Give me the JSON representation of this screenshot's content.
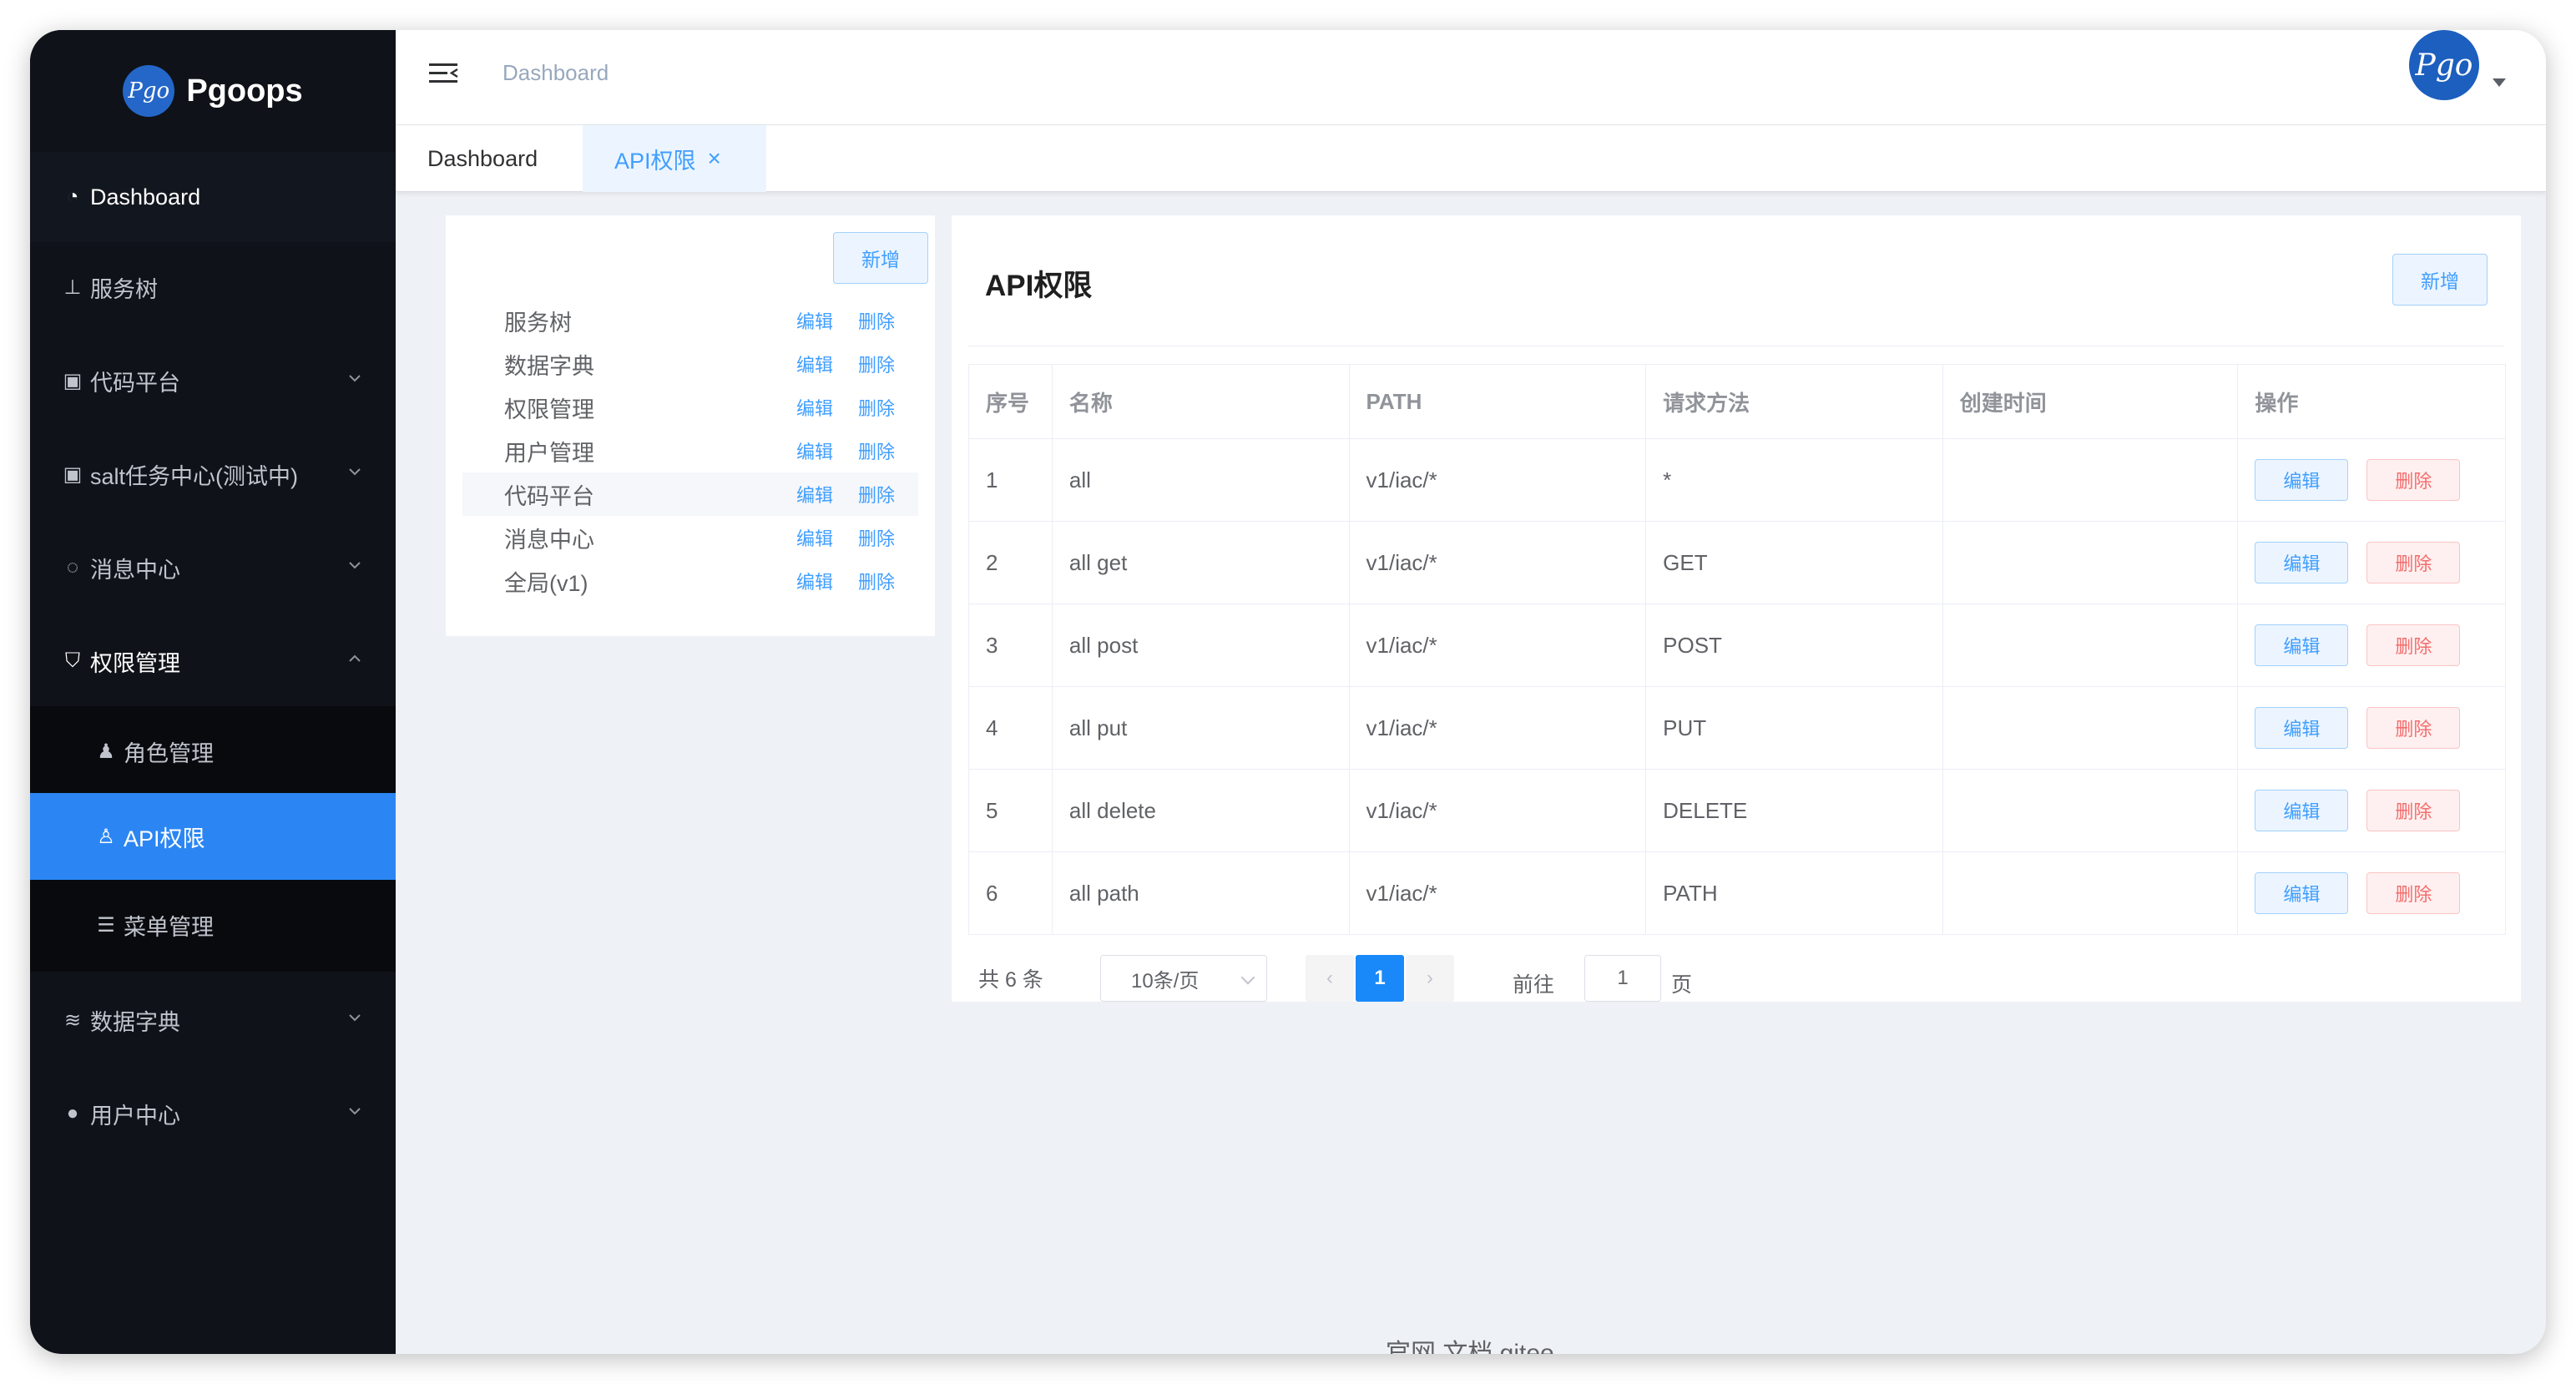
{
  "app": {
    "name": "Pgoops",
    "logo_mark": "Pgo"
  },
  "sidebar": {
    "items": [
      {
        "label": "Dashboard",
        "icon": "dashboard-icon",
        "glyph": "◔"
      },
      {
        "label": "服务树",
        "icon": "sitemap-icon",
        "glyph": "⊥"
      },
      {
        "label": "代码平台",
        "icon": "document-icon",
        "glyph": "▣"
      },
      {
        "label": "salt任务中心(测试中)",
        "icon": "document-icon",
        "glyph": "▣"
      },
      {
        "label": "消息中心",
        "icon": "chat-icon",
        "glyph": "◌"
      },
      {
        "label": "权限管理",
        "icon": "shield-icon",
        "glyph": "⛉"
      },
      {
        "label": "角色管理",
        "icon": "user-tie-icon",
        "glyph": "♟"
      },
      {
        "label": "API权限",
        "icon": "user-icon",
        "glyph": "♙"
      },
      {
        "label": "菜单管理",
        "icon": "list-icon",
        "glyph": "☰"
      },
      {
        "label": "数据字典",
        "icon": "layers-icon",
        "glyph": "≋"
      },
      {
        "label": "用户中心",
        "icon": "user-solid-icon",
        "glyph": "●"
      }
    ]
  },
  "header": {
    "breadcrumb": "Dashboard",
    "avatar_mark": "Pgo"
  },
  "tabs": [
    {
      "label": "Dashboard"
    },
    {
      "label": "API权限",
      "close": "×"
    }
  ],
  "left_panel": {
    "add_label": "新增",
    "edit_label": "编辑",
    "delete_label": "删除",
    "items": [
      "服务树",
      "数据字典",
      "权限管理",
      "用户管理",
      "代码平台",
      "消息中心",
      "全局(v1)"
    ]
  },
  "right_panel": {
    "title": "API权限",
    "add_label": "新增",
    "columns": [
      "序号",
      "名称",
      "PATH",
      "请求方法",
      "创建时间",
      "操作"
    ],
    "rows": [
      {
        "id": "1",
        "name": "all",
        "path": "v1/iac/*",
        "method": "*",
        "created": ""
      },
      {
        "id": "2",
        "name": "all get",
        "path": "v1/iac/*",
        "method": "GET",
        "created": ""
      },
      {
        "id": "3",
        "name": "all post",
        "path": "v1/iac/*",
        "method": "POST",
        "created": ""
      },
      {
        "id": "4",
        "name": "all put",
        "path": "v1/iac/*",
        "method": "PUT",
        "created": ""
      },
      {
        "id": "5",
        "name": "all delete",
        "path": "v1/iac/*",
        "method": "DELETE",
        "created": ""
      },
      {
        "id": "6",
        "name": "all path",
        "path": "v1/iac/*",
        "method": "PATH",
        "created": ""
      }
    ],
    "edit_label": "编辑",
    "delete_label": "删除"
  },
  "pagination": {
    "total_text": "共 6 条",
    "page_size": "10条/页",
    "prev": "‹",
    "next": "›",
    "current": "1",
    "goto_prefix": "前往",
    "goto_value": "1",
    "goto_suffix": "页"
  },
  "footer": {
    "text": "官网 文档 gitee"
  },
  "colors": {
    "sidebar_bg": "#0f1218",
    "active": "#2b86f3",
    "primary": "#409eff",
    "danger": "#f56c6c"
  }
}
